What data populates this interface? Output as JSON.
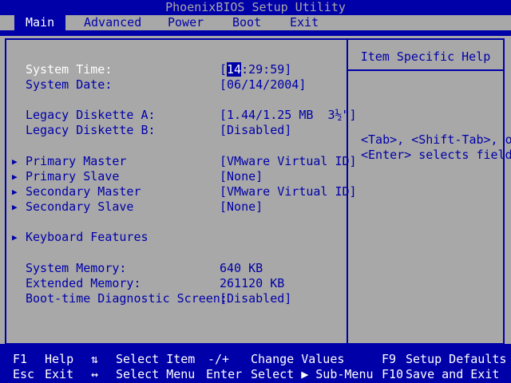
{
  "title": "PhoenixBIOS Setup Utility",
  "menu": [
    "Main",
    "Advanced",
    "Power",
    "Boot",
    "Exit"
  ],
  "main": {
    "system_time": {
      "label": "System Time:",
      "hour": "14",
      "rest": ":29:59]"
    },
    "system_date": {
      "label": "System Date:",
      "value": "[06/14/2004]"
    },
    "legacy_a": {
      "label": "Legacy Diskette A:",
      "value": "[1.44/1.25 MB  3½\"]"
    },
    "legacy_b": {
      "label": "Legacy Diskette B:",
      "value": "[Disabled]"
    },
    "primary_master": {
      "label": "Primary Master",
      "value": "[VMware Virtual ID]"
    },
    "primary_slave": {
      "label": "Primary Slave",
      "value": "[None]"
    },
    "secondary_master": {
      "label": "Secondary Master",
      "value": "[VMware Virtual ID]"
    },
    "secondary_slave": {
      "label": "Secondary Slave",
      "value": "[None]"
    },
    "keyboard_features": {
      "label": "Keyboard Features"
    },
    "system_memory": {
      "label": "System Memory:",
      "value": "640 KB"
    },
    "extended_memory": {
      "label": "Extended Memory:",
      "value": "261120 KB"
    },
    "boot_diag": {
      "label": "Boot-time Diagnostic Screen:",
      "value": "[Disabled]"
    }
  },
  "help": {
    "title": "Item Specific Help",
    "lines": [
      "<Tab>, <Shift-Tab>, or",
      "<Enter> selects field."
    ]
  },
  "footer": {
    "f1": "F1",
    "help": "Help",
    "updown_icon": "⇅",
    "select_item": "Select Item",
    "minus_plus": "-/+",
    "change_values": "Change Values",
    "f9": "F9",
    "setup_defaults": "Setup Defaults",
    "esc": "Esc",
    "exit": "Exit",
    "leftright_icon": "↔",
    "select_menu": "Select Menu",
    "enter": "Enter",
    "select_submenu": "Select ▶ Sub-Menu",
    "f10": "F10",
    "save_exit": "Save and Exit"
  }
}
